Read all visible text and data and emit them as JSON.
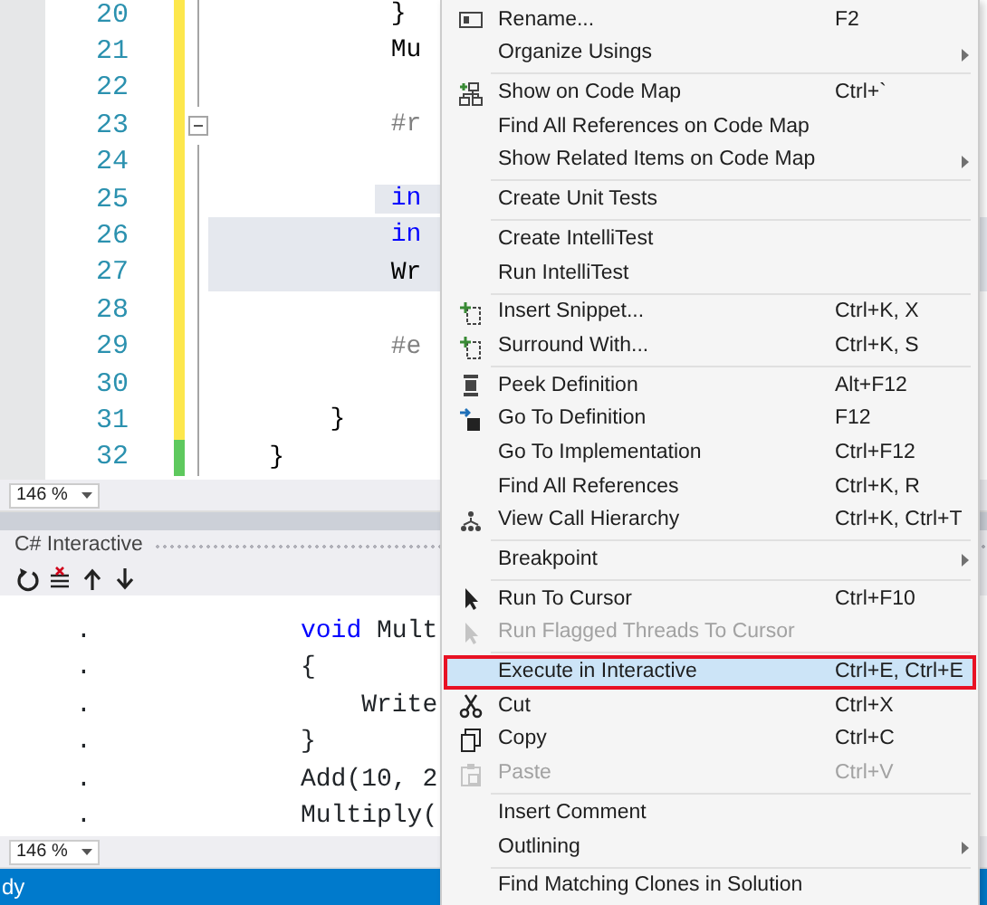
{
  "editor": {
    "lines": [
      {
        "number": "20",
        "code": "            }",
        "selected": false,
        "color": "#fde74c",
        "fold": false
      },
      {
        "number": "21",
        "code": "            Mu",
        "selected": false,
        "color": "#fde74c",
        "fold": false
      },
      {
        "number": "22",
        "selected": false,
        "color": "#fde74c",
        "fold": false
      },
      {
        "number": "23",
        "code": "            #r",
        "selected": false,
        "color": "#fde74c",
        "fold": true
      },
      {
        "number": "24",
        "selected": false,
        "color": "#fde74c",
        "fold": false
      },
      {
        "number": "25",
        "code": "            in",
        "selected": true,
        "color": "#fde74c",
        "fold": false
      },
      {
        "number": "26",
        "code": "            in",
        "selected": true,
        "color": "#fde74c",
        "fold": false
      },
      {
        "number": "27",
        "code": "            Wr",
        "selected": true,
        "color": "#fde74c",
        "fold": false
      },
      {
        "number": "28",
        "selected": false,
        "color": "#fde74c",
        "fold": false
      },
      {
        "number": "29",
        "code": "            #e",
        "selected": false,
        "color": "#fde74c",
        "fold": false
      },
      {
        "number": "30",
        "selected": false,
        "color": "#fde74c",
        "fold": false
      },
      {
        "number": "31",
        "code": "        }",
        "selected": false,
        "color": "#fde74c",
        "fold": false
      },
      {
        "number": "32",
        "code": "    }",
        "selected": false,
        "color": "#5ec95e",
        "fold": false
      }
    ],
    "zoom": "146 %"
  },
  "interactive": {
    "title": "C# Interactive",
    "lines": [
      {
        "prompt": ".",
        "code": "void Mult",
        "keyword": true
      },
      {
        "prompt": ".",
        "code": "{",
        "keyword": false
      },
      {
        "prompt": ".",
        "code": "    Write",
        "keyword": false
      },
      {
        "prompt": ".",
        "code": "}",
        "keyword": false
      },
      {
        "prompt": ".",
        "code": "Add(10, 2",
        "keyword": false
      },
      {
        "prompt": ".",
        "code": "Multiply(",
        "keyword": false
      }
    ],
    "zoom": "146 %"
  },
  "status_bar": {
    "text": "dy"
  },
  "context_menu": {
    "items": [
      {
        "kind": "item",
        "label": "Rename...",
        "shortcut": "F2",
        "submenu": false,
        "disabled": false,
        "selected": false
      },
      {
        "kind": "item",
        "label": "Organize Usings",
        "submenu": true,
        "disabled": false,
        "selected": false
      },
      {
        "kind": "separator"
      },
      {
        "kind": "item",
        "label": "Show on Code Map",
        "shortcut": "Ctrl+`",
        "submenu": false,
        "disabled": false,
        "selected": false
      },
      {
        "kind": "item",
        "label": "Find All References on Code Map",
        "submenu": false,
        "disabled": false,
        "selected": false
      },
      {
        "kind": "item",
        "label": "Show Related Items on Code Map",
        "submenu": true,
        "disabled": false,
        "selected": false
      },
      {
        "kind": "separator"
      },
      {
        "kind": "item",
        "label": "Create Unit Tests",
        "submenu": false,
        "disabled": false,
        "selected": false
      },
      {
        "kind": "separator"
      },
      {
        "kind": "item",
        "label": "Create IntelliTest",
        "submenu": false,
        "disabled": false,
        "selected": false
      },
      {
        "kind": "item",
        "label": "Run IntelliTest",
        "submenu": false,
        "disabled": false,
        "selected": false
      },
      {
        "kind": "separator"
      },
      {
        "kind": "item",
        "label": "Insert Snippet...",
        "shortcut": "Ctrl+K, X",
        "submenu": false,
        "disabled": false,
        "selected": false
      },
      {
        "kind": "item",
        "label": "Surround With...",
        "shortcut": "Ctrl+K, S",
        "submenu": false,
        "disabled": false,
        "selected": false
      },
      {
        "kind": "separator"
      },
      {
        "kind": "item",
        "label": "Peek Definition",
        "shortcut": "Alt+F12",
        "submenu": false,
        "disabled": false,
        "selected": false
      },
      {
        "kind": "item",
        "label": "Go To Definition",
        "shortcut": "F12",
        "submenu": false,
        "disabled": false,
        "selected": false
      },
      {
        "kind": "item",
        "label": "Go To Implementation",
        "shortcut": "Ctrl+F12",
        "submenu": false,
        "disabled": false,
        "selected": false
      },
      {
        "kind": "item",
        "label": "Find All References",
        "shortcut": "Ctrl+K, R",
        "submenu": false,
        "disabled": false,
        "selected": false
      },
      {
        "kind": "item",
        "label": "View Call Hierarchy",
        "shortcut": "Ctrl+K, Ctrl+T",
        "submenu": false,
        "disabled": false,
        "selected": false
      },
      {
        "kind": "separator"
      },
      {
        "kind": "item",
        "label": "Breakpoint",
        "submenu": true,
        "disabled": false,
        "selected": false
      },
      {
        "kind": "separator"
      },
      {
        "kind": "item",
        "label": "Run To Cursor",
        "shortcut": "Ctrl+F10",
        "submenu": false,
        "disabled": false,
        "selected": false
      },
      {
        "kind": "item",
        "label": "Run Flagged Threads To Cursor",
        "submenu": false,
        "disabled": true,
        "selected": false
      },
      {
        "kind": "separator"
      },
      {
        "kind": "item",
        "label": "Execute in Interactive",
        "shortcut": "Ctrl+E, Ctrl+E",
        "submenu": false,
        "disabled": false,
        "selected": true
      },
      {
        "kind": "item",
        "label": "Cut",
        "shortcut": "Ctrl+X",
        "submenu": false,
        "disabled": false,
        "selected": false
      },
      {
        "kind": "item",
        "label": "Copy",
        "shortcut": "Ctrl+C",
        "submenu": false,
        "disabled": false,
        "selected": false
      },
      {
        "kind": "item",
        "label": "Paste",
        "shortcut": "Ctrl+V",
        "submenu": false,
        "disabled": true,
        "selected": false
      },
      {
        "kind": "separator"
      },
      {
        "kind": "item",
        "label": "Insert Comment",
        "submenu": false,
        "disabled": false,
        "selected": false
      },
      {
        "kind": "item",
        "label": "Outlining",
        "submenu": true,
        "disabled": false,
        "selected": false
      },
      {
        "kind": "separator"
      },
      {
        "kind": "item",
        "label": "Find Matching Clones in Solution",
        "submenu": false,
        "disabled": false,
        "selected": false
      }
    ]
  }
}
